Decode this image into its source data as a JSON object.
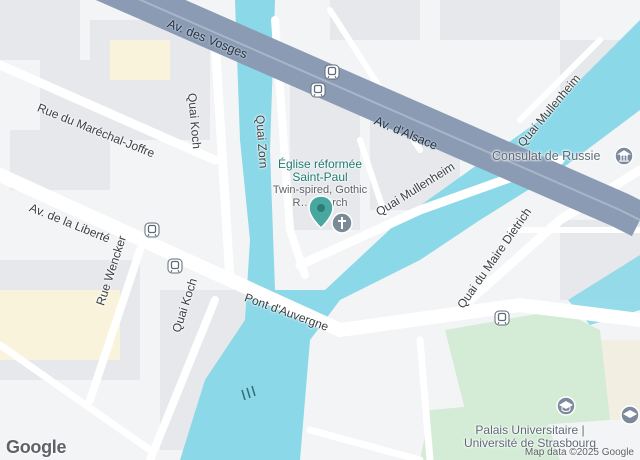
{
  "map": {
    "streets": {
      "av_des_vosges": "Av. des Vosges",
      "av_dalsace": "Av. d'Alsace",
      "quai_mullenheim_ne": "Quai Mullenheim",
      "quai_mullenheim_mid": "Quai Mullenheim",
      "quai_koch_top": "Quai Koch",
      "quai_koch_bottom": "Quai Koch",
      "quai_zorn": "Quai Zorn",
      "rue_marechal_joffre": "Rue du Maréchal-Joffre",
      "av_de_la_liberte": "Av. de la Liberté",
      "rue_wencker": "Rue Wencker",
      "pont_dauvergne": "Pont d'Auvergne",
      "quai_du_maire_dietrich": "Quai du Maire Dietrich"
    },
    "pois": {
      "eglise": {
        "name_line1": "Église réformée",
        "name_line2": "Saint-Paul",
        "subtitle_line1": "Twin-spired, Gothic",
        "subtitle_line2": "R… church"
      },
      "consulat": {
        "name": "Consulat de Russie"
      },
      "palais": {
        "name_line1": "Palais Universitaire |",
        "name_line2": "Université de Strasbourg"
      }
    },
    "attribution": "Map data ©2025 Google",
    "logo": "Google",
    "colors": {
      "water": "#8bd8e8",
      "highway": "#8a9bb3",
      "road": "#ffffff",
      "block": "#e8eaed",
      "park": "#d4ecd6",
      "marker": "#48a8a0"
    },
    "icons": [
      "tram-icon",
      "place-of-worship-icon",
      "consulate-icon",
      "university-icon",
      "map-pin-icon"
    ]
  }
}
